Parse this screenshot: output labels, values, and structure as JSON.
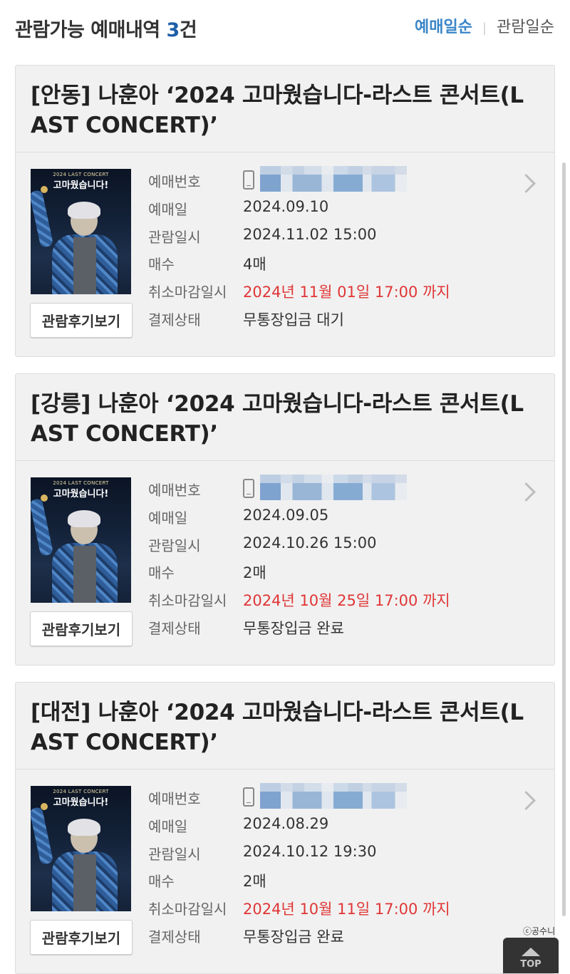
{
  "header": {
    "title_prefix": "관람가능 예매내역 ",
    "count": "3",
    "title_suffix": "건",
    "sort_booking": "예매일순",
    "sort_divider": "|",
    "sort_viewing": "관람일순"
  },
  "labels": {
    "booking_no": "예매번호",
    "booking_date": "예매일",
    "view_datetime": "관람일시",
    "quantity": "매수",
    "cancel_deadline": "취소마감일시",
    "payment_status": "결제상태",
    "review_button": "관람후기보기"
  },
  "poster": {
    "top_text": "2024 LAST CONCERT",
    "title_text": "고마웠습니다!"
  },
  "bookings": [
    {
      "title": "[안동] 나훈아 ‘2024 고마웠습니다-라스트 콘서트(LAST CONCERT)’",
      "booking_date": "2024.09.10",
      "view_datetime": "2024.11.02 15:00",
      "quantity": "4매",
      "cancel_deadline": "2024년 11월 01일 17:00 까지",
      "payment_status": "무통장입금 대기"
    },
    {
      "title": "[강릉] 나훈아 ‘2024 고마웠습니다-라스트 콘서트(LAST CONCERT)’",
      "booking_date": "2024.09.05",
      "view_datetime": "2024.10.26 15:00",
      "quantity": "2매",
      "cancel_deadline": "2024년 10월 25일 17:00 까지",
      "payment_status": "무통장입금 완료"
    },
    {
      "title": "[대전] 나훈아 ‘2024 고마웠습니다-라스트 콘서트(LAST CONCERT)’",
      "booking_date": "2024.08.29",
      "view_datetime": "2024.10.12 19:30",
      "quantity": "2매",
      "cancel_deadline": "2024년 10월 11일 17:00 까지",
      "payment_status": "무통장입금 완료"
    }
  ],
  "watermark": "ⓒ공수니",
  "top_button": "TOP"
}
